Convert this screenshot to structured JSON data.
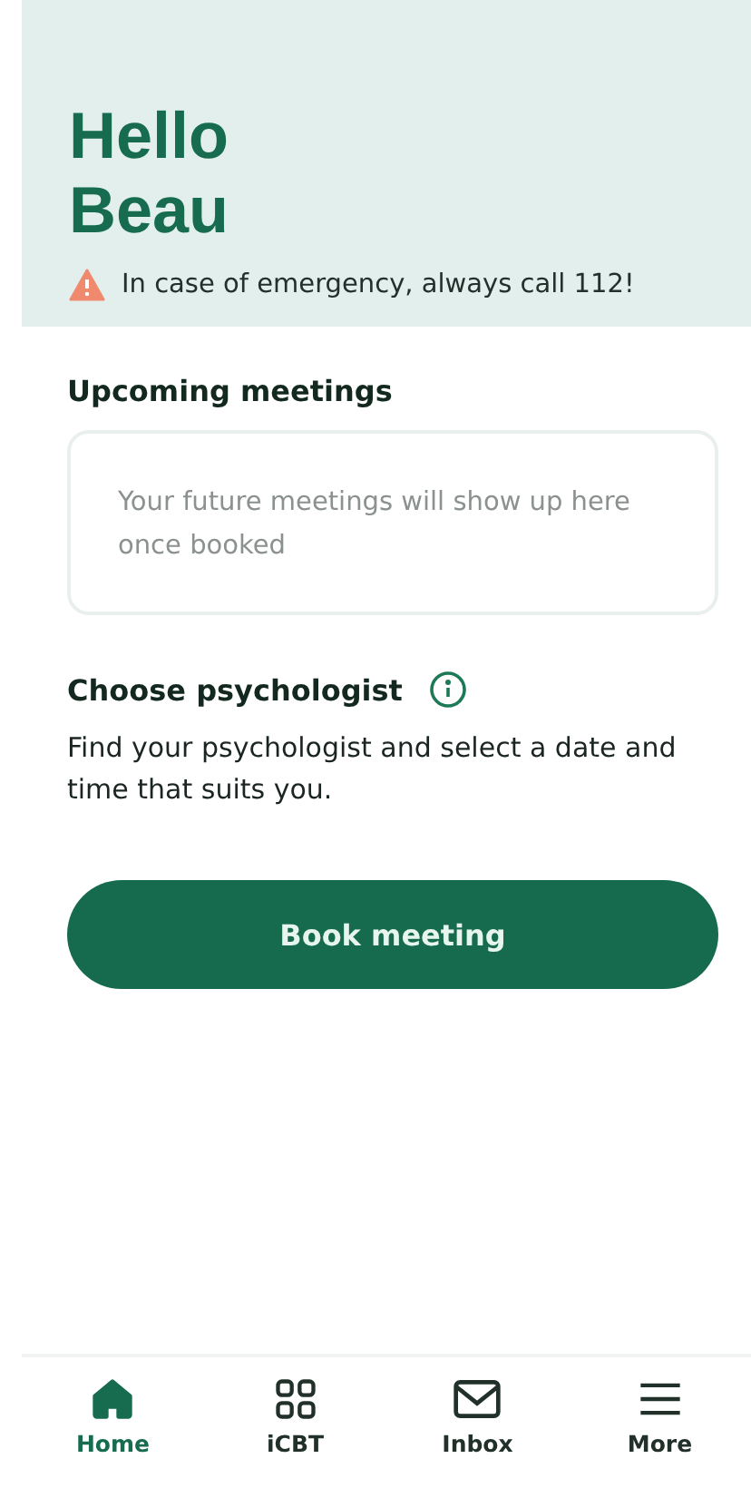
{
  "header": {
    "greeting": [
      "Hello",
      "Beau"
    ],
    "alert": "In case of emergency, always call 112!"
  },
  "upcoming": {
    "title": "Upcoming meetings",
    "empty_text": "Your future meetings will show up here once booked"
  },
  "psychologist": {
    "title": "Choose psychologist",
    "description": "Find your psychologist and select a date and time that suits you.",
    "button": "Book meeting"
  },
  "nav": [
    {
      "kind": "home",
      "label": "Home",
      "selected": true
    },
    {
      "kind": "grid",
      "label": "iCBT",
      "selected": false
    },
    {
      "kind": "mail",
      "label": "Inbox",
      "selected": false
    },
    {
      "kind": "menu",
      "label": "More",
      "selected": false
    }
  ]
}
